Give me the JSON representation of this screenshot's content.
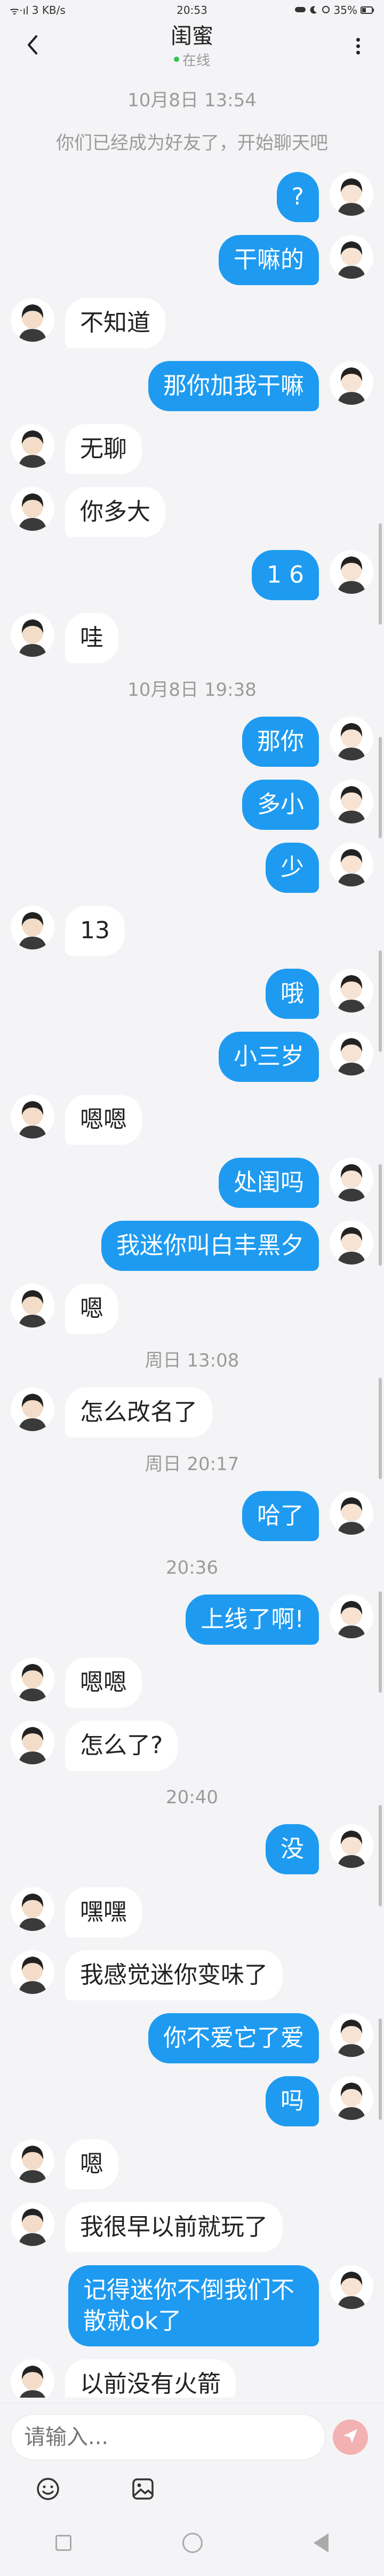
{
  "status_bar": {
    "signal": "ᯤ·ıl",
    "network_speed": "3 KB/s",
    "time": "20:53",
    "battery": "35%"
  },
  "header": {
    "title": "闺蜜",
    "status": "在线"
  },
  "conversation": [
    {
      "kind": "time",
      "text": "10月8日 13:54"
    },
    {
      "kind": "notice",
      "text": "你们已经成为好友了，开始聊天吧"
    },
    {
      "kind": "msg",
      "side": "right",
      "text": "?"
    },
    {
      "kind": "msg",
      "side": "right",
      "text": "干嘛的"
    },
    {
      "kind": "msg",
      "side": "left",
      "text": "不知道"
    },
    {
      "kind": "msg",
      "side": "right",
      "text": "那你加我干嘛"
    },
    {
      "kind": "msg",
      "side": "left",
      "text": "无聊"
    },
    {
      "kind": "msg",
      "side": "left",
      "text": "你多大"
    },
    {
      "kind": "msg",
      "side": "right",
      "text": "1 6"
    },
    {
      "kind": "msg",
      "side": "left",
      "text": "哇"
    },
    {
      "kind": "time",
      "text": "10月8日 19:38"
    },
    {
      "kind": "msg",
      "side": "right",
      "text": "那你"
    },
    {
      "kind": "msg",
      "side": "right",
      "text": "多小"
    },
    {
      "kind": "msg",
      "side": "right",
      "text": "少"
    },
    {
      "kind": "msg",
      "side": "left",
      "text": "13"
    },
    {
      "kind": "msg",
      "side": "right",
      "text": "哦"
    },
    {
      "kind": "msg",
      "side": "right",
      "text": "小三岁"
    },
    {
      "kind": "msg",
      "side": "left",
      "text": "嗯嗯"
    },
    {
      "kind": "msg",
      "side": "right",
      "text": "处闺吗"
    },
    {
      "kind": "msg",
      "side": "right",
      "text": "我迷你叫白丰黑夕"
    },
    {
      "kind": "msg",
      "side": "left",
      "text": "嗯"
    },
    {
      "kind": "time",
      "text": "周日 13:08"
    },
    {
      "kind": "msg",
      "side": "left",
      "text": "怎么改名了"
    },
    {
      "kind": "time",
      "text": "周日 20:17"
    },
    {
      "kind": "msg",
      "side": "right",
      "text": "哈了"
    },
    {
      "kind": "time",
      "text": "20:36"
    },
    {
      "kind": "msg",
      "side": "right",
      "text": "上线了啊!"
    },
    {
      "kind": "msg",
      "side": "left",
      "text": "嗯嗯"
    },
    {
      "kind": "msg",
      "side": "left",
      "text": "怎么了?"
    },
    {
      "kind": "time",
      "text": "20:40"
    },
    {
      "kind": "msg",
      "side": "right",
      "text": "没"
    },
    {
      "kind": "msg",
      "side": "left",
      "text": "嘿嘿"
    },
    {
      "kind": "msg",
      "side": "left",
      "text": "我感觉迷你变味了"
    },
    {
      "kind": "msg",
      "side": "right",
      "text": "你不爱它了爱"
    },
    {
      "kind": "msg",
      "side": "right",
      "text": "吗"
    },
    {
      "kind": "msg",
      "side": "left",
      "text": "嗯"
    },
    {
      "kind": "msg",
      "side": "left",
      "text": "我很早以前就玩了"
    },
    {
      "kind": "msg",
      "side": "right",
      "text": "记得迷你不倒我们不散就ok了"
    },
    {
      "kind": "msg",
      "side": "left",
      "text": "以前没有火箭"
    },
    {
      "kind": "msg",
      "side": "right",
      "text": "😞😞😞😢😢😢😢",
      "emoji": true
    }
  ],
  "input": {
    "placeholder": "请输入..."
  },
  "colors": {
    "my_bubble": "#1e9bf0",
    "their_bubble": "#ffffff",
    "background": "#f4f4f6",
    "online_dot": "#38c14c",
    "send_button": "#f3b1b1"
  },
  "icons": {
    "back": "chevron-left-icon",
    "more": "more-vertical-icon",
    "emoji": "smiley-icon",
    "image": "image-icon",
    "send": "send-icon"
  }
}
